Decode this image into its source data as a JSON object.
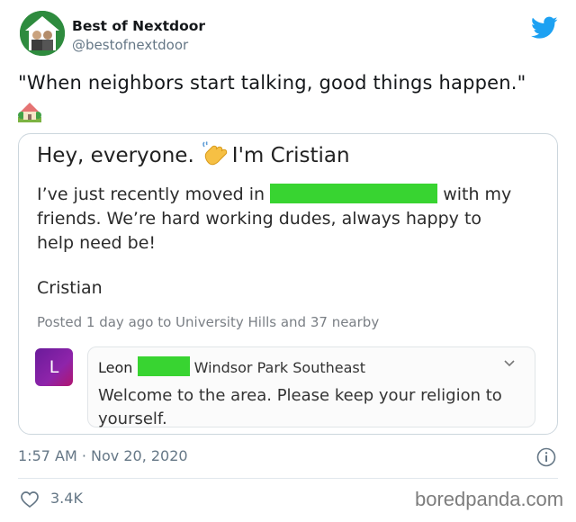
{
  "account": {
    "name": "Best of Nextdoor",
    "handle": "@bestofnextdoor"
  },
  "tweet": {
    "text": "\"When neighbors start talking, good things happen.\"",
    "emoji": "house-with-garden"
  },
  "embedded_post": {
    "heading_start": "Hey, everyone.",
    "heading_end": "I'm Cristian",
    "heading_emoji": "waving-hand",
    "body_line1_start": "I’ve just recently moved in",
    "body_line1_end": "with my",
    "body_line2": "friends.  We’re hard working dudes, always happy to",
    "body_line3": "help need be!",
    "signature": "Cristian",
    "posted_meta": "Posted 1 day ago to University Hills and 37 nearby",
    "redaction_color": "#38d431",
    "reply": {
      "avatar_letter": "L",
      "name": "Leon",
      "neighborhood": "Windsor Park Southeast",
      "text": "Welcome to the area. Please keep your religion to yourself."
    }
  },
  "footer": {
    "timestamp": "1:57 AM · Nov 20, 2020",
    "likes": "3.4K"
  },
  "watermark": "boredpanda.com",
  "colors": {
    "twitter_blue": "#1da1f2",
    "muted_text": "#657786",
    "nextdoor_green": "#2e8b3e"
  }
}
